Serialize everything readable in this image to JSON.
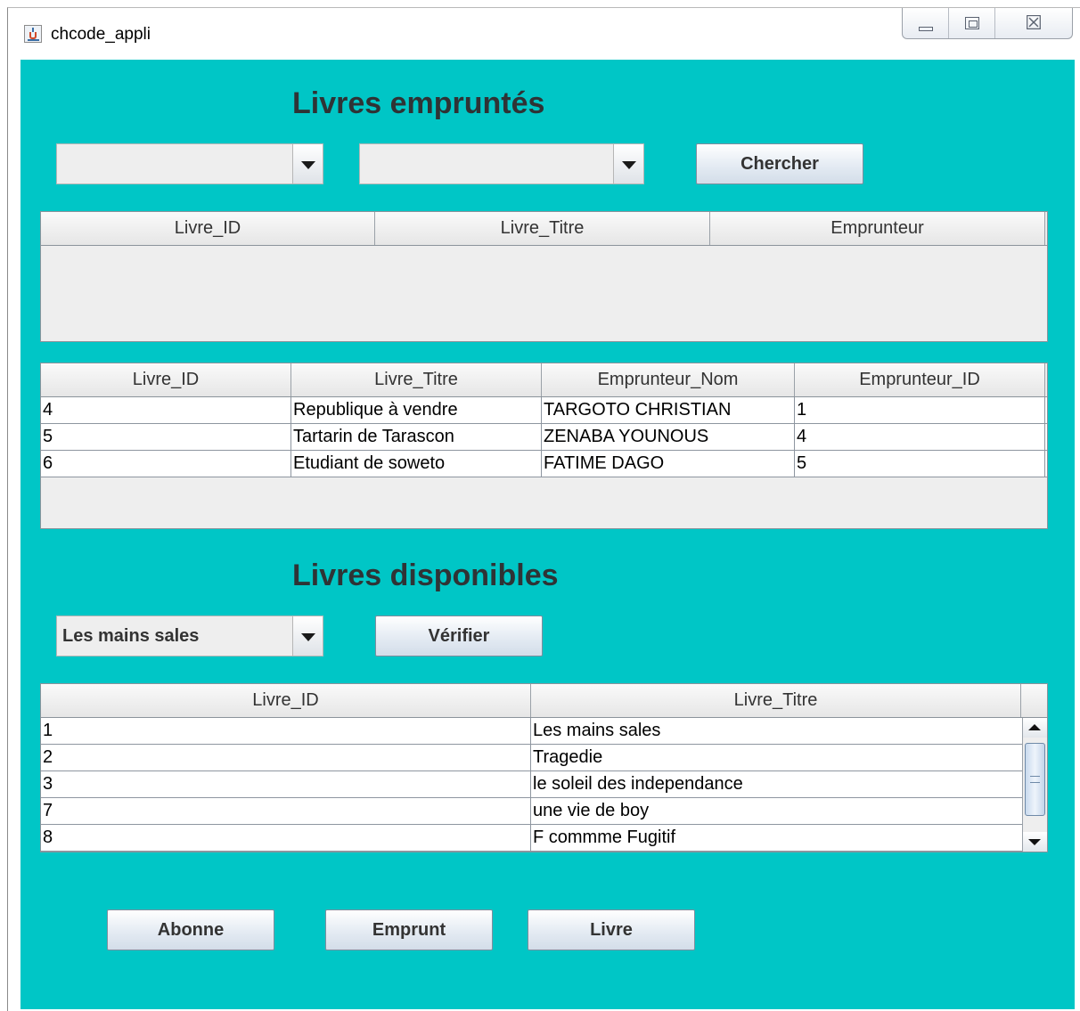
{
  "window": {
    "title": "chcode_appli",
    "controls": {
      "minimize_icon": "minimize-icon",
      "maximize_icon": "maximize-icon",
      "close_glyph": "☒"
    }
  },
  "borrowed": {
    "heading": "Livres empruntés",
    "combo1_value": "",
    "combo2_value": "",
    "search_button": "Chercher",
    "search_table": {
      "columns": [
        "Livre_ID",
        "Livre_Titre",
        "Emprunteur"
      ],
      "rows": []
    },
    "list_table": {
      "columns": [
        "Livre_ID",
        "Livre_Titre",
        "Emprunteur_Nom",
        "Emprunteur_ID"
      ],
      "rows": [
        [
          "4",
          "Republique à vendre",
          "TARGOTO CHRISTIAN",
          "1"
        ],
        [
          "5",
          "Tartarin de Tarascon",
          "ZENABA YOUNOUS",
          "4"
        ],
        [
          "6",
          "Etudiant de soweto",
          "FATIME DAGO",
          "5"
        ]
      ]
    }
  },
  "available": {
    "heading": "Livres disponibles",
    "combo_value": "Les mains sales",
    "verify_button": "Vérifier",
    "table": {
      "columns": [
        "Livre_ID",
        "Livre_Titre"
      ],
      "rows": [
        [
          "1",
          "Les mains sales"
        ],
        [
          "2",
          "Tragedie"
        ],
        [
          "3",
          "le soleil des independance"
        ],
        [
          "7",
          "une vie de boy"
        ],
        [
          "8",
          "F commme Fugitif"
        ]
      ]
    }
  },
  "footer": {
    "abonne_button": "Abonne",
    "emprunt_button": "Emprunt",
    "livre_button": "Livre"
  },
  "colors": {
    "panel_background": "#00c6c6",
    "heading_text": "#2f3335",
    "table_background": "#eeeeee"
  }
}
